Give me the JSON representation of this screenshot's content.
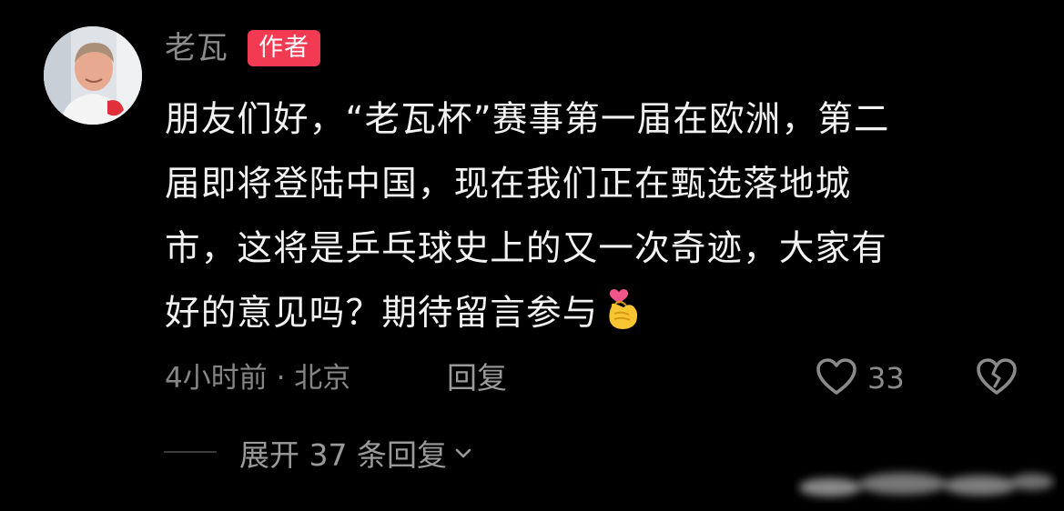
{
  "comment": {
    "username": "老瓦",
    "author_badge": "作者",
    "lines": [
      "朋友们好，“老瓦杯”赛事第一届在欧洲，第二",
      "届即将登陆中国，现在我们正在甄选落地城",
      "市，这将是乒乓球史上的又一次奇迹，大家有",
      "好的意见吗？期待留言参与"
    ],
    "trailing_emoji": "finger-heart-emoji",
    "meta": "4小时前 · 北京",
    "reply_label": "回复",
    "like_count": "33",
    "expand_replies_label": "展开 37 条回复"
  },
  "colors": {
    "background": "#000000",
    "badge": "#f23a52",
    "secondary_text": "#8a8a8a"
  },
  "icons": {
    "like": "heart-outline-icon",
    "dislike": "broken-heart-icon",
    "expand": "chevron-down-icon"
  }
}
